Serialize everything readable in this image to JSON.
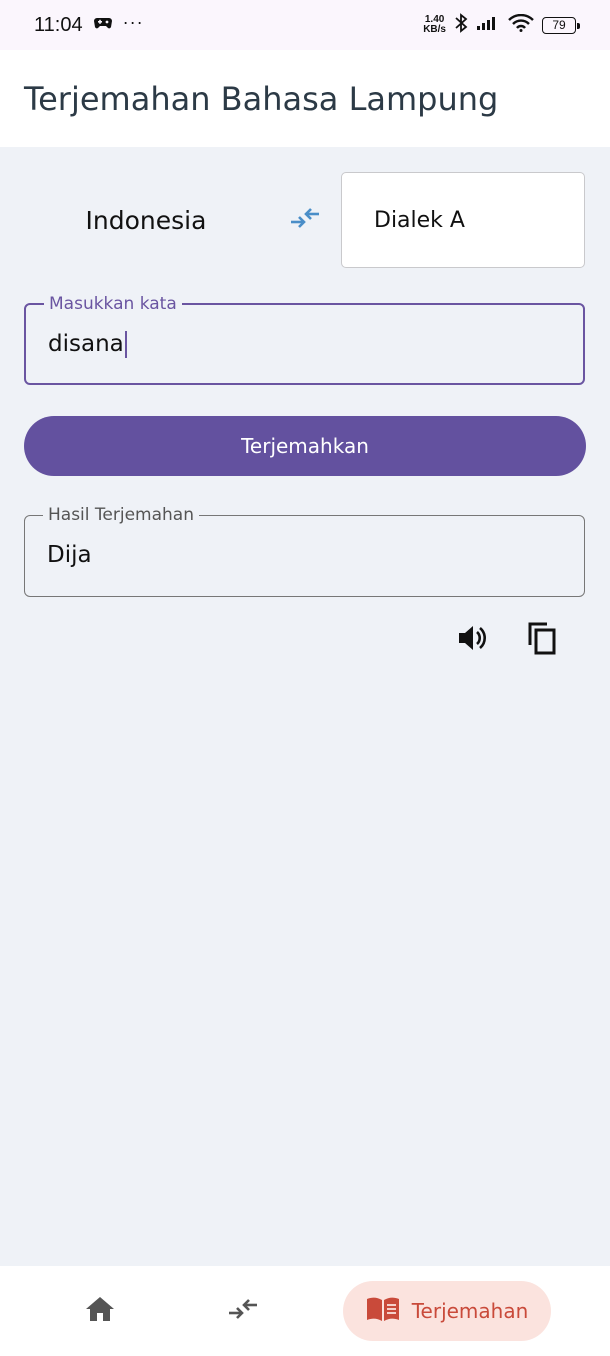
{
  "status_bar": {
    "time": "11:04",
    "dots": "···",
    "net_speed_value": "1.40",
    "net_speed_unit": "KB/s",
    "battery": "79"
  },
  "app_bar": {
    "title": "Terjemahan Bahasa Lampung"
  },
  "language": {
    "source": "Indonesia",
    "target": "Dialek A",
    "swap_icon": "swap-arrows-icon"
  },
  "input": {
    "label": "Masukkan kata",
    "value": "disana"
  },
  "translate_button": {
    "label": "Terjemahkan"
  },
  "result": {
    "label": "Hasil Terjemahan",
    "value": "Dija"
  },
  "actions": {
    "speaker_icon": "speaker-icon",
    "copy_icon": "copy-icon"
  },
  "bottom_nav": {
    "items": [
      {
        "icon": "home-icon"
      },
      {
        "icon": "swap-arrows-icon"
      },
      {
        "icon": "book-icon",
        "label": "Terjemahan",
        "active": true
      }
    ]
  },
  "colors": {
    "primary": "#63519f",
    "accent_icon": "#4a8ec8",
    "nav_active_bg": "#fbe3de",
    "nav_active_fg": "#c94a3a",
    "background": "#eff2f7"
  }
}
